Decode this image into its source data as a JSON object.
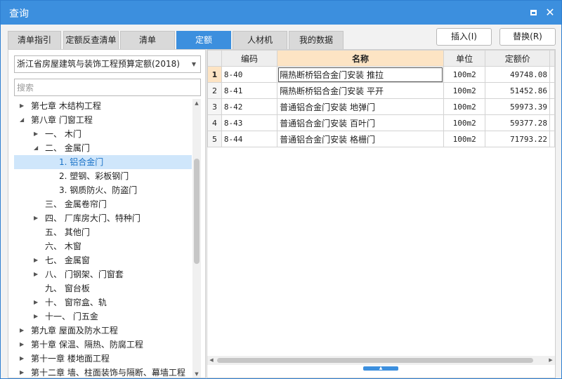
{
  "window": {
    "title": "查询"
  },
  "tabs": [
    {
      "label": "清单指引",
      "active": false
    },
    {
      "label": "定额反查清单",
      "active": false
    },
    {
      "label": "清单",
      "active": false
    },
    {
      "label": "定额",
      "active": true
    },
    {
      "label": "人材机",
      "active": false
    },
    {
      "label": "我的数据",
      "active": false
    }
  ],
  "buttons": {
    "insert": "插入(I)",
    "replace": "替换(R)"
  },
  "left": {
    "quota_select": "浙江省房屋建筑与装饰工程预算定额(2018)",
    "search_placeholder": "搜索",
    "tree": [
      {
        "label": "第七章 木结构工程",
        "toggle": "collapsed"
      },
      {
        "label": "第八章 门窗工程",
        "toggle": "expanded"
      },
      {
        "label": "一、 木门",
        "toggle": "collapsed"
      },
      {
        "label": "二、 金属门",
        "toggle": "expanded"
      },
      {
        "label": "1. 铝合金门",
        "toggle": "none",
        "selected": true
      },
      {
        "label": "2. 塑钢、彩板钢门",
        "toggle": "none"
      },
      {
        "label": "3. 钢质防火、防盗门",
        "toggle": "none"
      },
      {
        "label": "三、 金属卷帘门",
        "toggle": "none"
      },
      {
        "label": "四、 厂库房大门、特种门",
        "toggle": "collapsed"
      },
      {
        "label": "五、 其他门",
        "toggle": "none"
      },
      {
        "label": "六、 木窗",
        "toggle": "none"
      },
      {
        "label": "七、 金属窗",
        "toggle": "collapsed"
      },
      {
        "label": "八、 门钢架、门窗套",
        "toggle": "collapsed"
      },
      {
        "label": "九、 窗台板",
        "toggle": "none"
      },
      {
        "label": "十、 窗帘盒、轨",
        "toggle": "collapsed"
      },
      {
        "label": "十一、 门五金",
        "toggle": "collapsed"
      },
      {
        "label": "第九章 屋面及防水工程",
        "toggle": "collapsed"
      },
      {
        "label": "第十章 保温、隔热、防腐工程",
        "toggle": "collapsed"
      },
      {
        "label": "第十一章 楼地面工程",
        "toggle": "collapsed"
      },
      {
        "label": "第十二章 墙、柱面装饰与隔断、幕墙工程",
        "toggle": "collapsed"
      }
    ]
  },
  "grid": {
    "headers": {
      "code": "编码",
      "name": "名称",
      "unit": "单位",
      "price": "定额价"
    },
    "rows": [
      {
        "num": "1",
        "code": "8-40",
        "name": "隔热断桥铝合金门安装 推拉",
        "unit": "100m2",
        "price": "49748.08"
      },
      {
        "num": "2",
        "code": "8-41",
        "name": "隔热断桥铝合金门安装 平开",
        "unit": "100m2",
        "price": "51452.86"
      },
      {
        "num": "3",
        "code": "8-42",
        "name": "普通铝合金门安装 地弹门",
        "unit": "100m2",
        "price": "59973.39"
      },
      {
        "num": "4",
        "code": "8-43",
        "name": "普通铝合金门安装 百叶门",
        "unit": "100m2",
        "price": "59377.28"
      },
      {
        "num": "5",
        "code": "8-44",
        "name": "普通铝合金门安装 格栅门",
        "unit": "100m2",
        "price": "71793.22"
      }
    ]
  },
  "colors": {
    "accent": "#3c8fde",
    "selected_bg": "#cfe6fb",
    "header_highlight": "#fde4c4"
  }
}
